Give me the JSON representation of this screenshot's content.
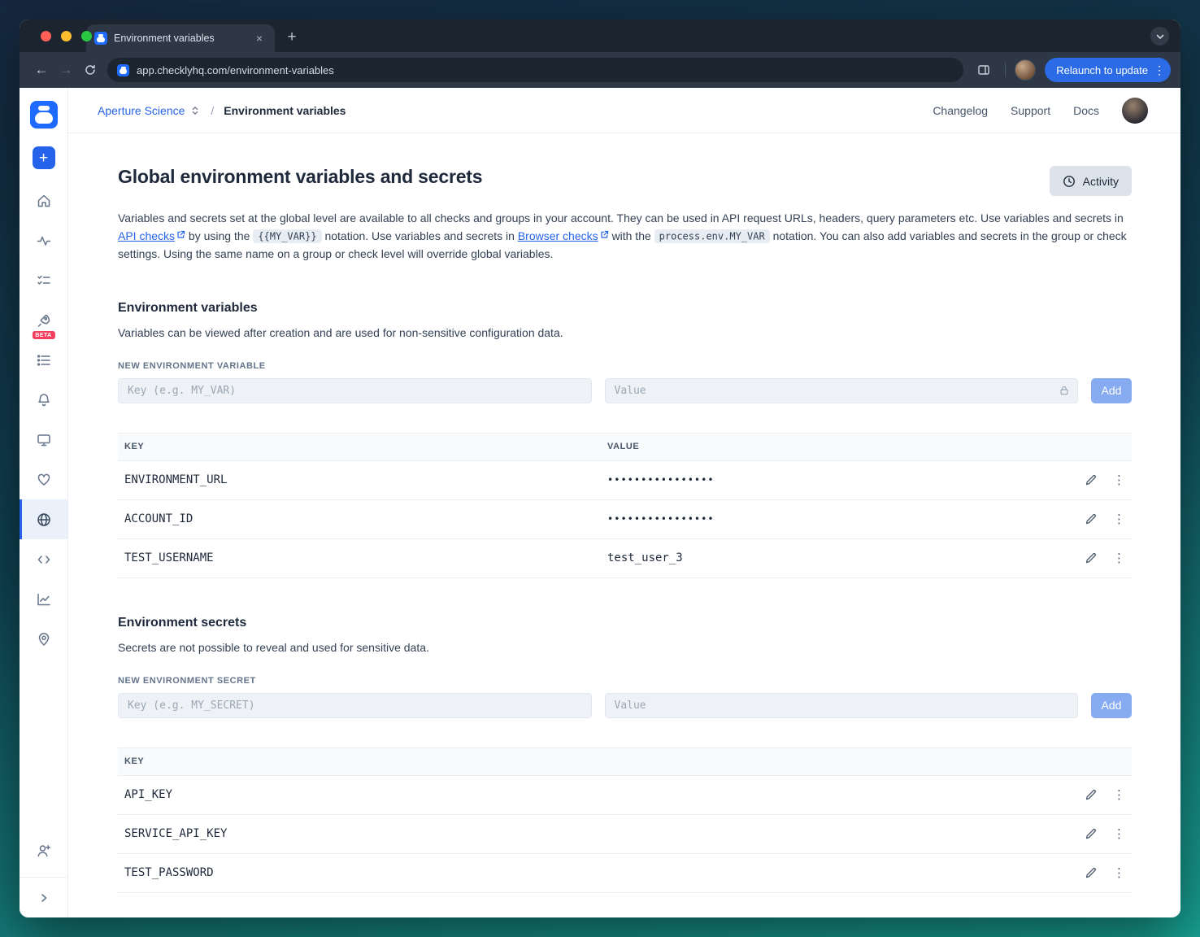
{
  "colors": {
    "accent_blue": "#2563eb",
    "relaunch_blue": "#2b6be6",
    "beta_pink": "#f43f5e",
    "traffic_red": "#ff5f57",
    "traffic_yellow": "#febc2e",
    "traffic_green": "#28c840"
  },
  "glyphs": {
    "kebab": "⋮",
    "close": "×",
    "plus": "+",
    "back": "←",
    "forward": "→"
  },
  "browser": {
    "tab_title": "Environment variables",
    "url": "app.checklyhq.com/environment-variables",
    "relaunch_label": "Relaunch to update"
  },
  "sidebar": {
    "beta_label": "BETA"
  },
  "app_header": {
    "account": "Aperture Science",
    "separator": "/",
    "current": "Environment variables",
    "links": [
      "Changelog",
      "Support",
      "Docs"
    ]
  },
  "page": {
    "title": "Global environment variables and secrets",
    "activity_button": "Activity",
    "intro": {
      "part1": "Variables and secrets set at the global level are available to all checks and groups in your account. They can be used in API request URLs, headers, query parameters etc. Use variables and secrets in ",
      "link1": "API checks",
      "part2": " by using the ",
      "code1": "{{MY_VAR}}",
      "part3": " notation. Use variables and secrets in ",
      "link2": "Browser checks",
      "part4": " with the ",
      "code2": "process.env.MY_VAR",
      "part5": " notation. You can also add variables and secrets in the group or check settings. Using the same name on a group or check level will override global variables."
    }
  },
  "variables_section": {
    "title": "Environment variables",
    "description": "Variables can be viewed after creation and are used for non-sensitive configuration data.",
    "new_label": "NEW ENVIRONMENT VARIABLE",
    "key_placeholder": "Key (e.g. MY_VAR)",
    "value_placeholder": "Value",
    "add_label": "Add",
    "table": {
      "key_header": "KEY",
      "value_header": "VALUE",
      "rows": [
        {
          "key": "ENVIRONMENT_URL",
          "value": "••••••••••••••••",
          "masked": true
        },
        {
          "key": "ACCOUNT_ID",
          "value": "••••••••••••••••",
          "masked": true
        },
        {
          "key": "TEST_USERNAME",
          "value": "test_user_3",
          "masked": false
        }
      ]
    }
  },
  "secrets_section": {
    "title": "Environment secrets",
    "description": "Secrets are not possible to reveal and used for sensitive data.",
    "new_label": "NEW ENVIRONMENT SECRET",
    "key_placeholder": "Key (e.g. MY_SECRET)",
    "value_placeholder": "Value",
    "add_label": "Add",
    "table": {
      "key_header": "KEY",
      "rows": [
        {
          "key": "API_KEY"
        },
        {
          "key": "SERVICE_API_KEY"
        },
        {
          "key": "TEST_PASSWORD"
        }
      ]
    }
  }
}
